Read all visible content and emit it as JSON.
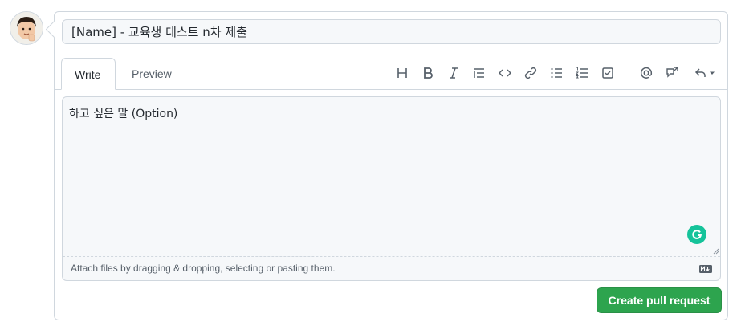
{
  "title_field": {
    "value": "[Name] - 교육생 테스트 n차 제출"
  },
  "tabs": [
    {
      "label": "Write",
      "active": true
    },
    {
      "label": "Preview",
      "active": false
    }
  ],
  "toolbar_icons": [
    "heading-icon",
    "bold-icon",
    "italic-icon",
    "quote-icon",
    "code-icon",
    "link-icon",
    "bulleted-list-icon",
    "numbered-list-icon",
    "task-list-icon",
    "mention-icon",
    "cross-reference-icon",
    "reply-icon"
  ],
  "editor": {
    "value": "하고 싶은 말 (Option)"
  },
  "attach": {
    "text": "Attach files by dragging & dropping, selecting or pasting them."
  },
  "submit_button": {
    "label": "Create pull request"
  },
  "colors": {
    "primary_button": "#2da44e",
    "border": "#d0d7de",
    "grammarly": "#15c39a"
  }
}
